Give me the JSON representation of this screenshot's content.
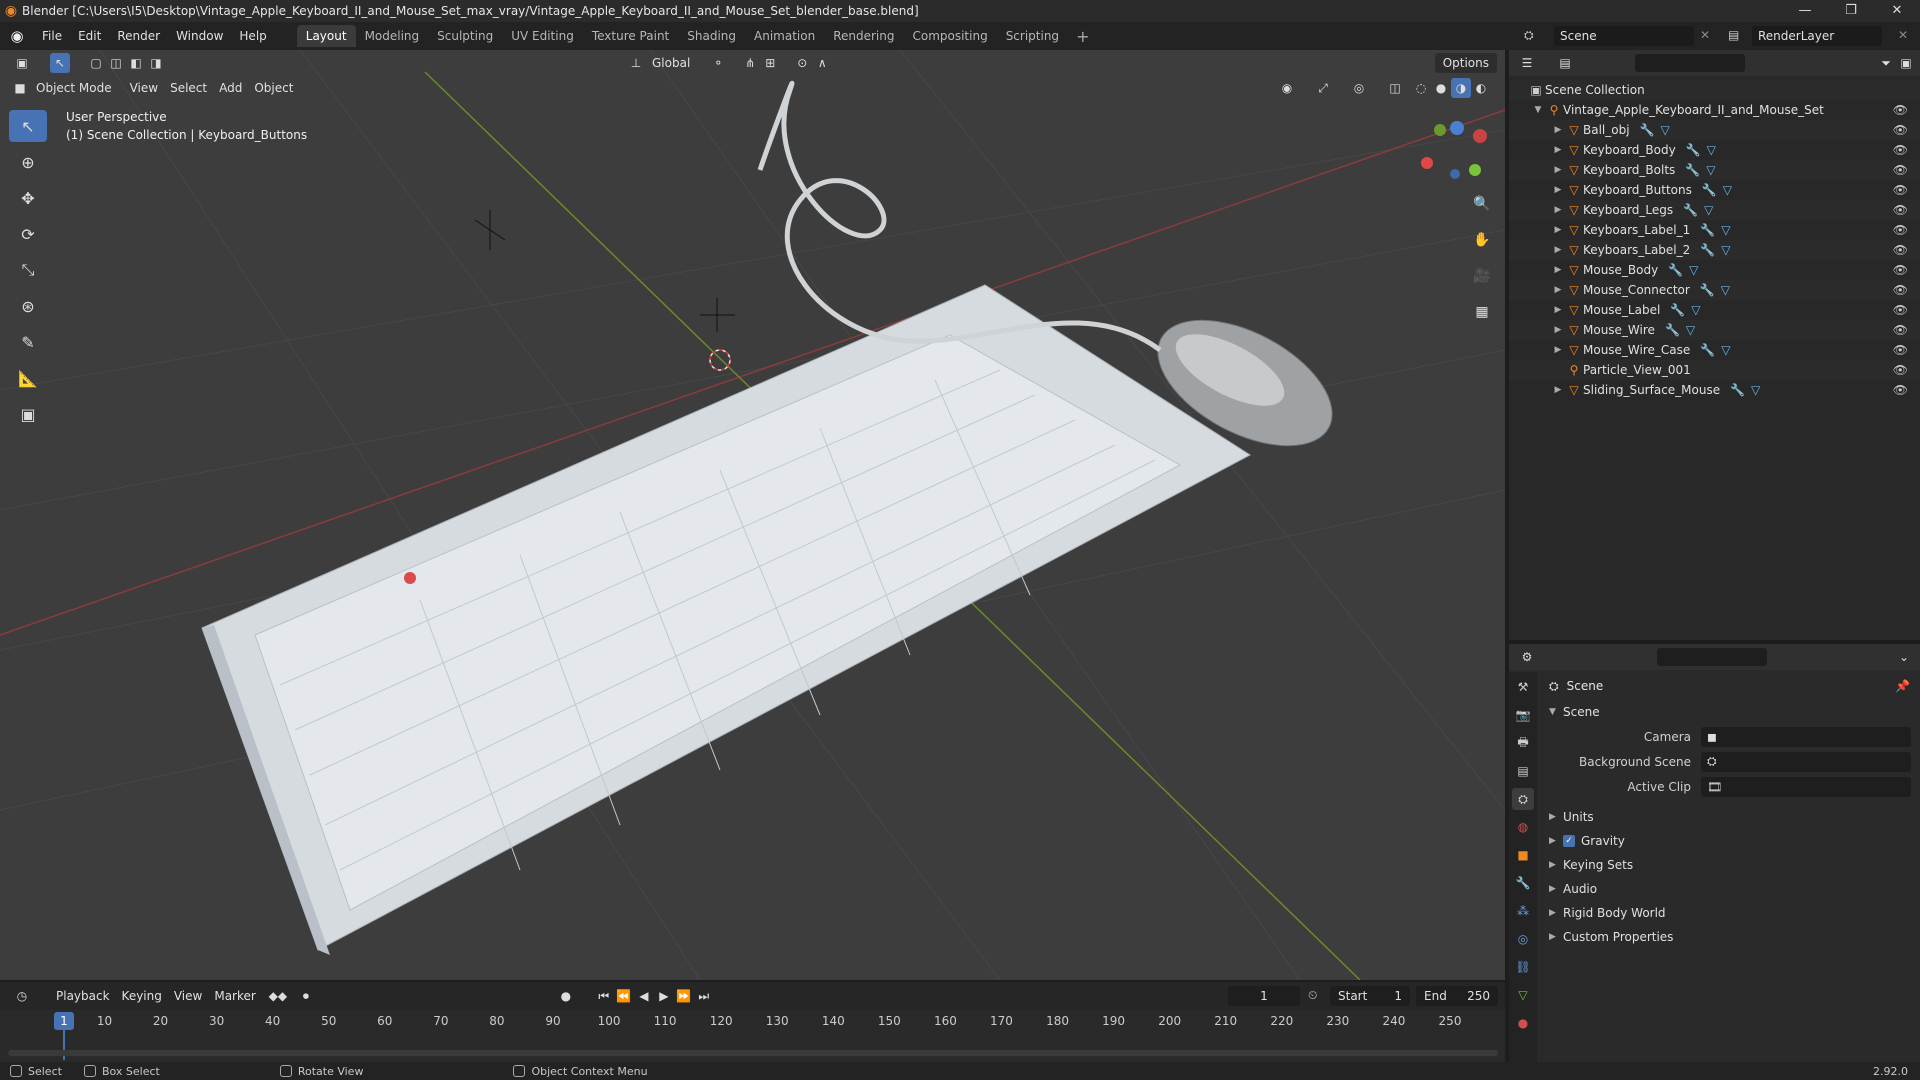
{
  "window": {
    "title": "Blender [C:\\Users\\I5\\Desktop\\Vintage_Apple_Keyboard_II_and_Mouse_Set_max_vray/Vintage_Apple_Keyboard_II_and_Mouse_Set_blender_base.blend]",
    "controls": [
      "—",
      "❐",
      "✕"
    ]
  },
  "menu": [
    "File",
    "Edit",
    "Render",
    "Window",
    "Help"
  ],
  "workspaces": [
    "Layout",
    "Modeling",
    "Sculpting",
    "UV Editing",
    "Texture Paint",
    "Shading",
    "Animation",
    "Rendering",
    "Compositing",
    "Scripting"
  ],
  "active_workspace": "Layout",
  "scene_name": "Scene",
  "view_layer": "RenderLayer",
  "viewport": {
    "mode": "Object Mode",
    "menus": [
      "View",
      "Select",
      "Add",
      "Object"
    ],
    "transform_orientation": "Global",
    "options_label": "Options",
    "info_line1": "User Perspective",
    "info_line2": "(1) Scene Collection | Keyboard_Buttons",
    "gizmo_axes": [
      "X",
      "Y",
      "Z"
    ]
  },
  "outliner": {
    "root": "Scene Collection",
    "collection": "Vintage_Apple_Keyboard_II_and_Mouse_Set",
    "items": [
      "Ball_obj",
      "Keyboard_Body",
      "Keyboard_Bolts",
      "Keyboard_Buttons",
      "Keyboard_Legs",
      "Keyboars_Label_1",
      "Keyboars_Label_2",
      "Mouse_Body",
      "Mouse_Connector",
      "Mouse_Label",
      "Mouse_Wire",
      "Mouse_Wire_Case",
      "Particle_View_001",
      "Sliding_Surface_Mouse"
    ]
  },
  "properties": {
    "context": "Scene",
    "panel": "Scene",
    "fields": [
      {
        "label": "Camera",
        "value": ""
      },
      {
        "label": "Background Scene",
        "value": ""
      },
      {
        "label": "Active Clip",
        "value": ""
      }
    ],
    "sections": [
      "Units",
      "Gravity",
      "Keying Sets",
      "Audio",
      "Rigid Body World",
      "Custom Properties"
    ],
    "gravity_checked": true
  },
  "timeline": {
    "menus": [
      "Playback",
      "Keying",
      "View",
      "Marker"
    ],
    "current_frame": "1",
    "start_label": "Start",
    "start": "1",
    "end_label": "End",
    "end": "250",
    "ticks": [
      "1",
      "10",
      "20",
      "30",
      "40",
      "50",
      "60",
      "70",
      "80",
      "90",
      "100",
      "110",
      "120",
      "130",
      "140",
      "150",
      "160",
      "170",
      "180",
      "190",
      "200",
      "210",
      "220",
      "230",
      "240",
      "250"
    ]
  },
  "status": {
    "select": "Select",
    "box_select": "Box Select",
    "rotate_view": "Rotate View",
    "context_menu": "Object Context Menu",
    "version": "2.92.0"
  }
}
